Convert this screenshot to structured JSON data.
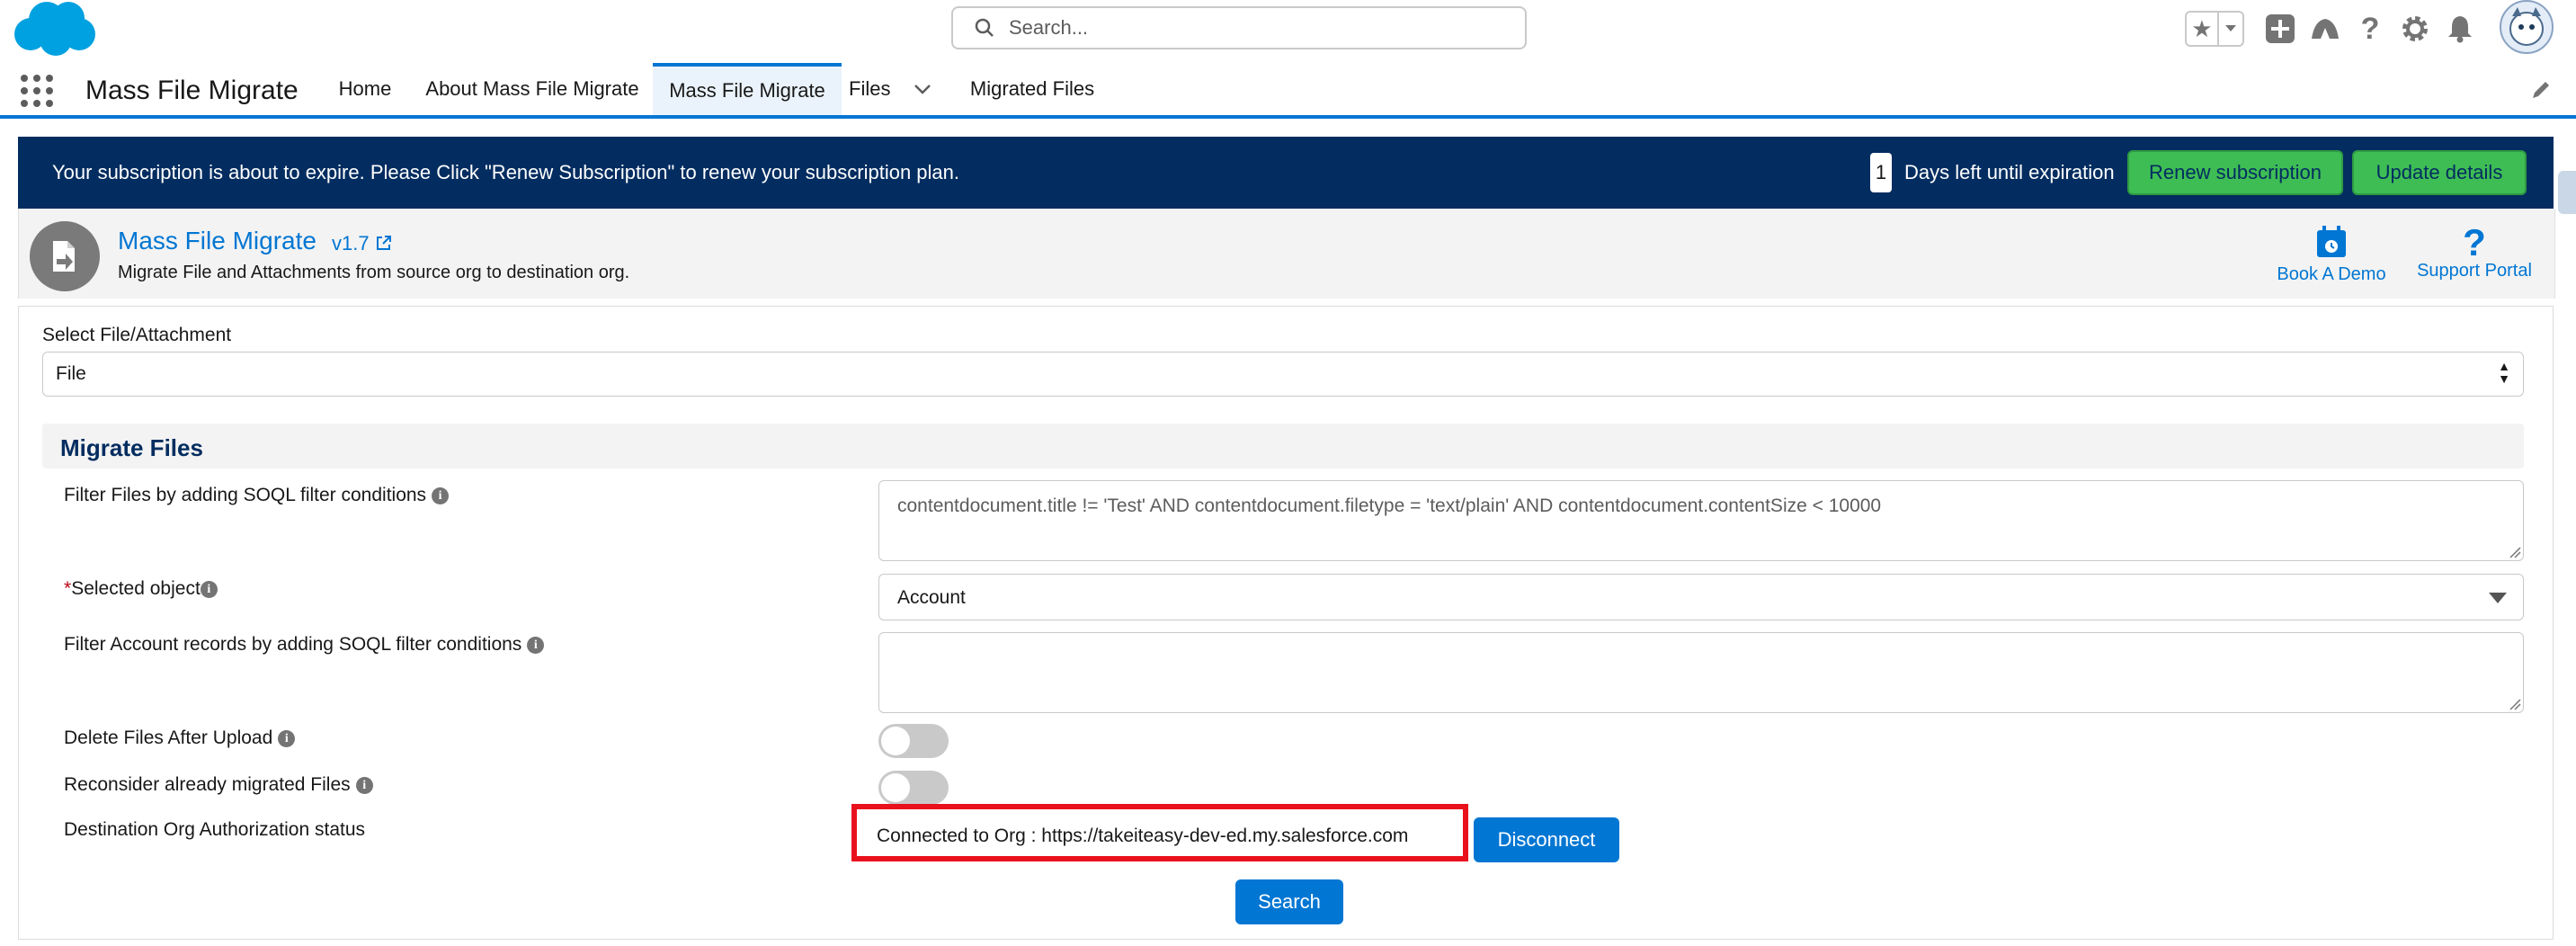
{
  "header": {
    "search_placeholder": "Search...",
    "icons": [
      "salesforce-cloud-logo",
      "search-icon",
      "favorites-star-icon",
      "chevron-down-icon",
      "add-icon",
      "trailhead-icon",
      "help-icon",
      "gear-icon",
      "bell-icon",
      "avatar"
    ]
  },
  "nav": {
    "app_name": "Mass File Migrate",
    "tabs": [
      {
        "label": "Home"
      },
      {
        "label": "About Mass File Migrate"
      },
      {
        "label": "Mass File Migrate",
        "active": true
      },
      {
        "label": "Files",
        "has_dropdown": true
      },
      {
        "label": "Migrated Files"
      }
    ]
  },
  "banner": {
    "message": "Your subscription is about to expire. Please Click \"Renew Subscription\" to renew your subscription plan.",
    "days_left": "1",
    "days_label": "Days left until expiration",
    "renew_label": "Renew subscription",
    "update_label": "Update details"
  },
  "app_header": {
    "title": "Mass File Migrate",
    "version": "v1.7",
    "description": "Migrate File and Attachments from source org to destination org.",
    "book_demo": "Book A Demo",
    "support_portal": "Support Portal"
  },
  "form": {
    "select_label": "Select File/Attachment",
    "select_value": "File",
    "section_title": "Migrate Files",
    "filter_files_label": "Filter Files by adding SOQL filter conditions",
    "filter_files_value": "contentdocument.title != 'Test' AND contentdocument.filetype = 'text/plain' AND contentdocument.contentSize < 10000",
    "required_mark": "*",
    "selected_object_label": "Selected object",
    "selected_object_value": "Account",
    "filter_account_label": "Filter Account records by adding SOQL filter conditions",
    "filter_account_value": "",
    "delete_files_label": "Delete Files After Upload",
    "delete_files_on": false,
    "reconsider_label": "Reconsider already migrated Files",
    "reconsider_on": false,
    "auth_status_label": "Destination Org Authorization status",
    "connected_text": "Connected to Org : https://takeiteasy-dev-ed.my.salesforce.com",
    "disconnect_label": "Disconnect",
    "search_label": "Search"
  },
  "colors": {
    "brand_blue": "#0176d3",
    "banner_navy": "#032d60",
    "green_button": "#3ebd54",
    "highlight_red": "#e8111c"
  }
}
